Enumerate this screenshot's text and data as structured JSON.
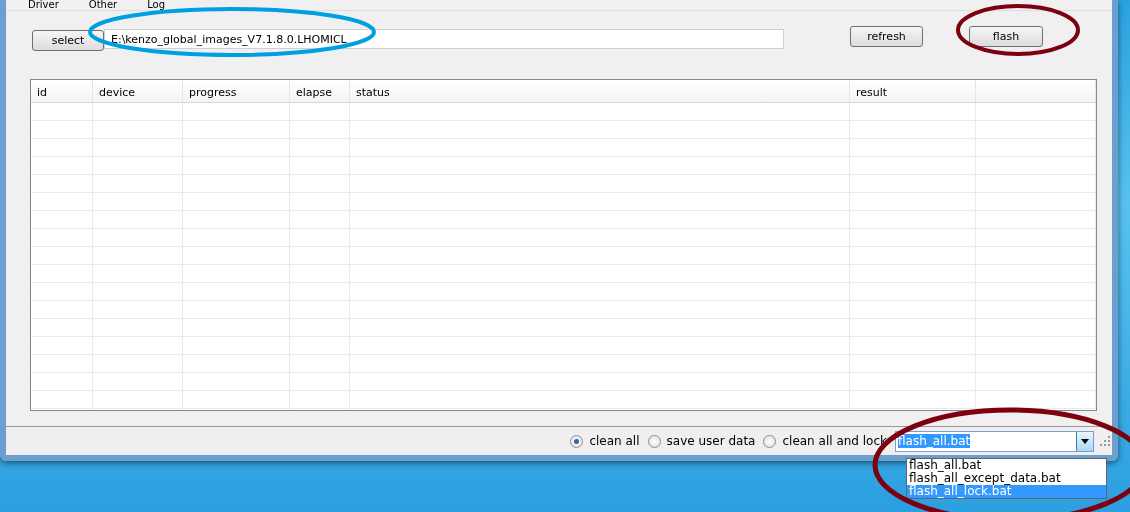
{
  "menu": [
    {
      "label": "Driver"
    },
    {
      "label": "Other"
    },
    {
      "label": "Log"
    }
  ],
  "toolbar": {
    "select_button": "select",
    "path": "E:\\kenzo_global_images_V7.1.8.0.LHOMICL",
    "refresh_button": "refresh",
    "flash_button": "flash"
  },
  "table": {
    "columns": [
      "id",
      "device",
      "progress",
      "elapse",
      "status",
      "result"
    ]
  },
  "options": [
    {
      "label": "clean all",
      "selected": true
    },
    {
      "label": "save user data",
      "selected": false
    },
    {
      "label": "clean all and lock",
      "selected": false
    }
  ],
  "script_combo": {
    "value": "flash_all.bat",
    "expanded": true,
    "items": [
      {
        "label": "flash_all.bat",
        "highlighted": false
      },
      {
        "label": "flash_all_except_data.bat",
        "highlighted": false
      },
      {
        "label": "flash_all_lock.bat",
        "highlighted": true
      }
    ]
  }
}
